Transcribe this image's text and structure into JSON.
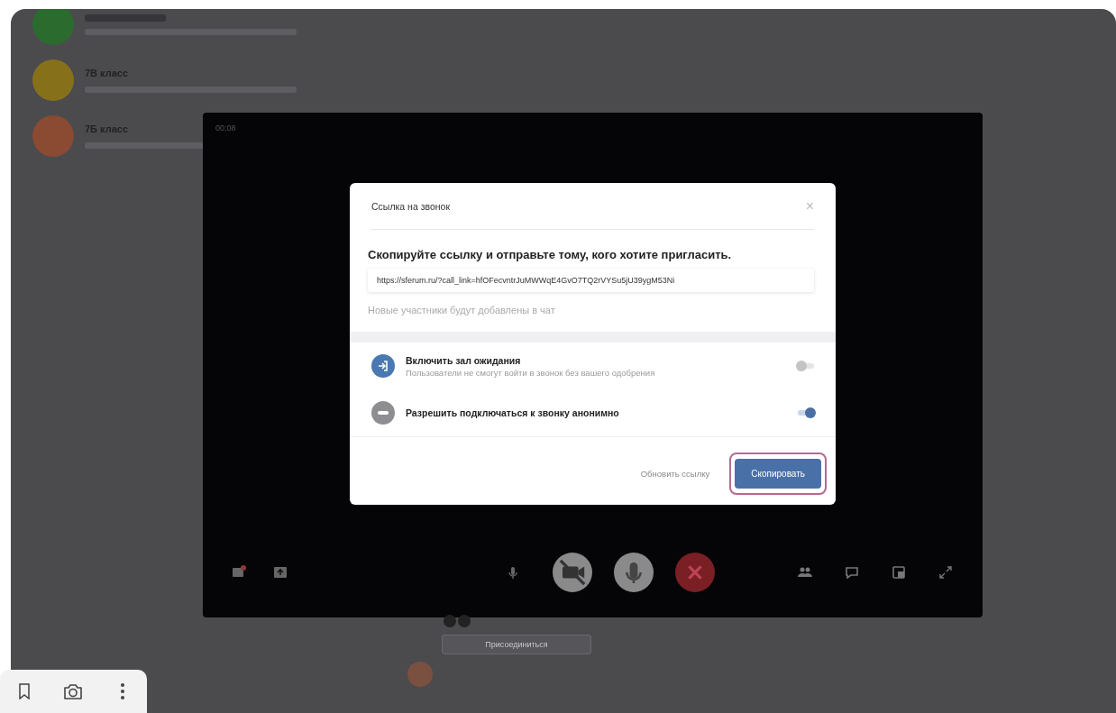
{
  "chats": [
    {
      "color": "#2b6b2e"
    },
    {
      "name": "7В класс",
      "color": "#86701a"
    },
    {
      "name": "7Б класс",
      "color": "#8a4b32"
    }
  ],
  "call": {
    "time": "00:08",
    "controls": [
      {
        "kind": "screen"
      },
      {
        "kind": "present"
      },
      {
        "kind": "mic-small"
      },
      {
        "kind": "video-off"
      },
      {
        "kind": "mic"
      },
      {
        "kind": "end"
      },
      {
        "kind": "people"
      },
      {
        "kind": "chat"
      },
      {
        "kind": "window"
      },
      {
        "kind": "fullscreen"
      }
    ]
  },
  "dialog": {
    "title": "Ссылка на звонок",
    "close": "×",
    "heading": "Скопируйте ссылку и отправьте тому, кого хотите пригласить.",
    "link": "https://sferum.ru/?call_link=hfOFecvntrJuMWWqE4GvO7TQ2rVYSu5jU39ygM53Ni",
    "note": "Новые участники будут добавлены в чат",
    "options": [
      {
        "kind": "waiting-room",
        "label": "Включить зал ожидания",
        "hint": "Пользователи не смогут войти в звонок без вашего одобрения",
        "on": false
      },
      {
        "kind": "anonymous",
        "label": "Разрешить подключаться к звонку анонимно",
        "on": true
      }
    ],
    "secondary": "Обновить ссылку",
    "primary": "Скопировать",
    "primary_highlighted": true
  },
  "join_button": "Присоединиться"
}
